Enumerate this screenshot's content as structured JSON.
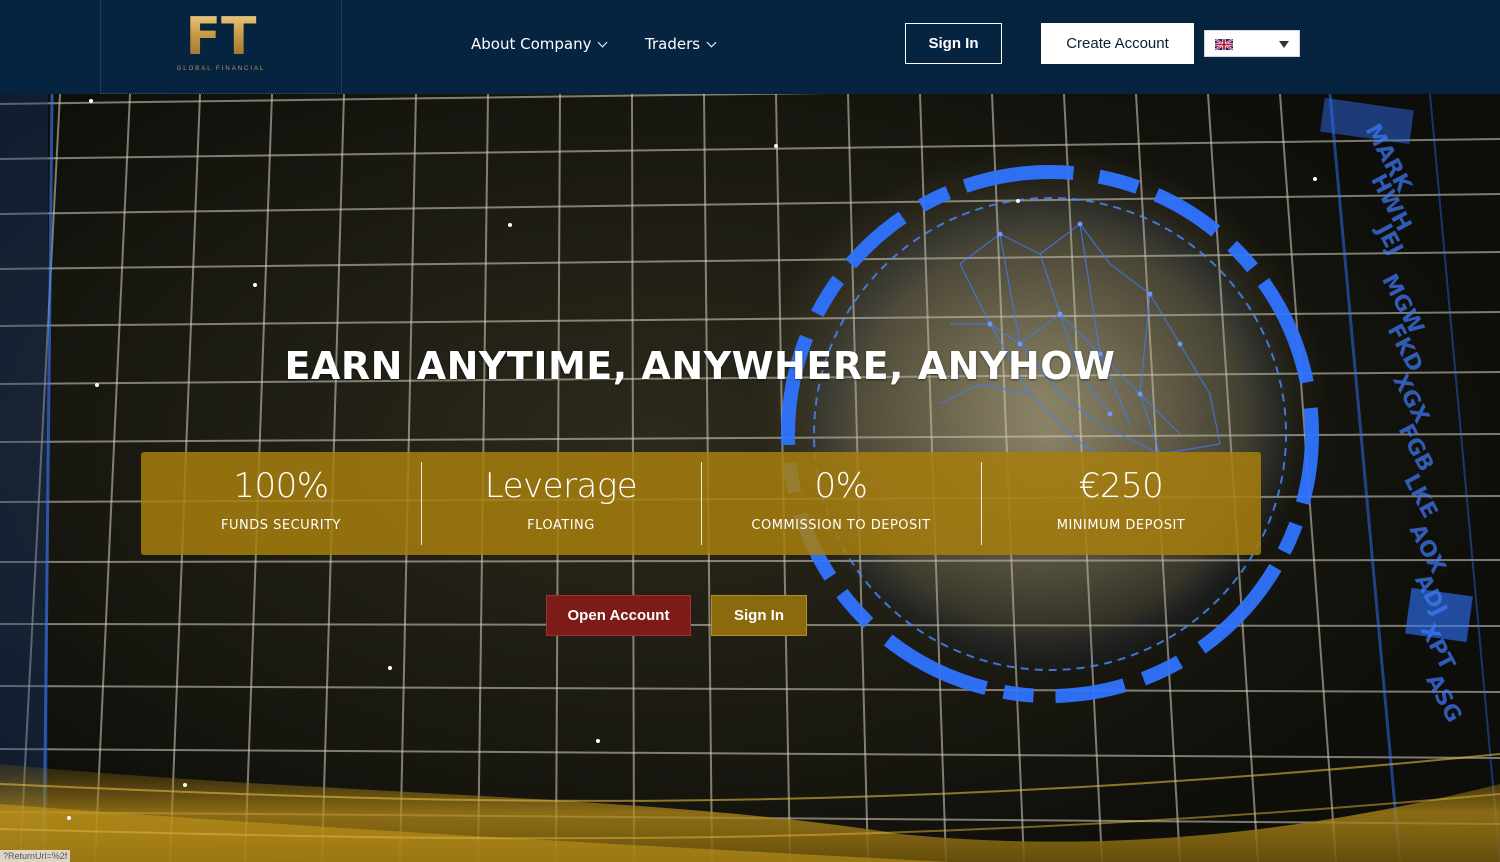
{
  "header": {
    "logo": {
      "mark": "FT",
      "subtitle": "GLOBAL FINANCIAL"
    },
    "nav": [
      {
        "label": "About Company"
      },
      {
        "label": "Traders"
      }
    ],
    "sign_in_label": "Sign In",
    "create_account_label": "Create Account",
    "language": {
      "flag": "uk-flag-icon"
    }
  },
  "hero": {
    "title": "EARN ANYTIME, ANYWHERE, ANYHOW",
    "stats": [
      {
        "value": "100%",
        "label": "FUNDS SECURITY"
      },
      {
        "value": "Leverage",
        "label": "FLOATING"
      },
      {
        "value": "0%",
        "label": "COMMISSION TO DEPOSIT"
      },
      {
        "value": "€250",
        "label": "MINIMUM DEPOSIT"
      }
    ],
    "open_account_label": "Open Account",
    "sign_in_label": "Sign In",
    "side_tickers": [
      "MARK",
      "HWH",
      "JEJ",
      "MGW",
      "FKD",
      "XGX",
      "FGB",
      "LKE",
      "AOX",
      "ADJ",
      "XPT",
      "ASG"
    ]
  },
  "status_bar": {
    "url": "?ReturnUrl=%2f"
  },
  "colors": {
    "header_bg": "#062440",
    "gold_band": "#a77e0e",
    "open_account_bg": "#7d1b18",
    "hero_sign_in_bg": "#8a6a0c",
    "hud_blue": "#2b6cf0"
  }
}
